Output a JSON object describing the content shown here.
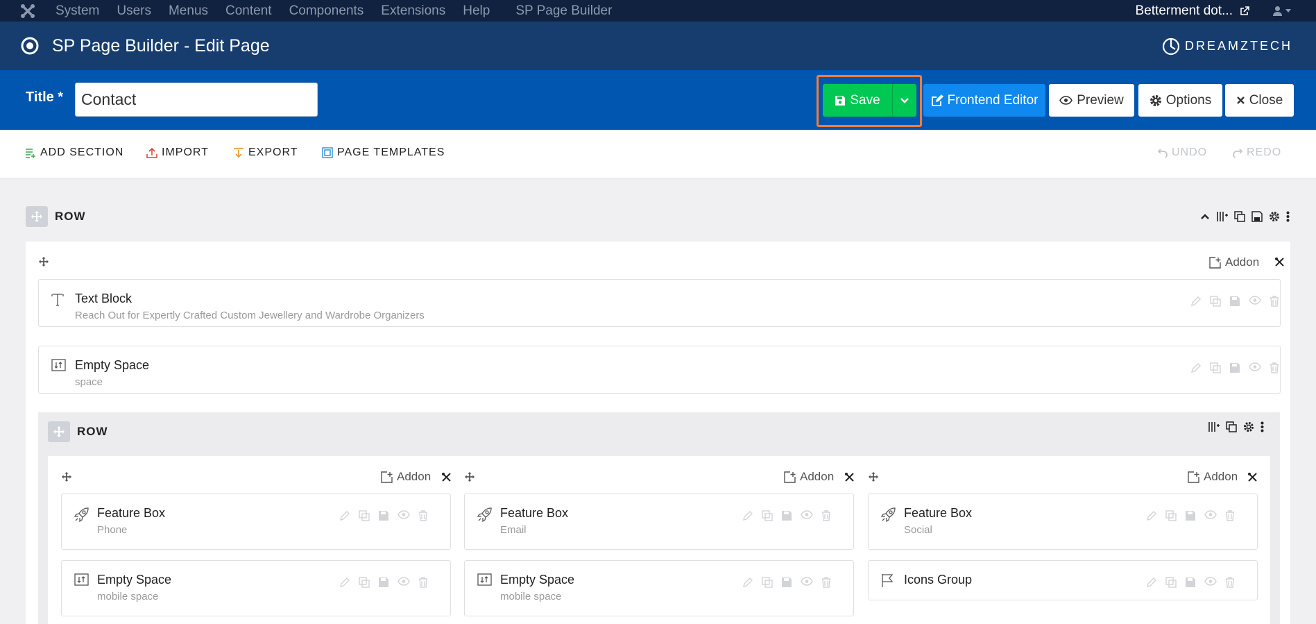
{
  "topbar": {
    "menu": [
      "System",
      "Users",
      "Menus",
      "Content",
      "Components",
      "Extensions",
      "Help",
      "SP Page Builder"
    ],
    "site_name": "Betterment dot..."
  },
  "header": {
    "title": "SP Page Builder - Edit Page",
    "brand": "DREAMZTECH"
  },
  "toolbar": {
    "title_label": "Title *",
    "title_value": "Contact",
    "save": "Save",
    "frontend_editor": "Frontend Editor",
    "preview": "Preview",
    "options": "Options",
    "close": "Close"
  },
  "actions": {
    "add_section": "ADD SECTION",
    "import": "IMPORT",
    "export": "EXPORT",
    "page_templates": "PAGE TEMPLATES",
    "undo": "UNDO",
    "redo": "REDO"
  },
  "row1": {
    "label": "ROW",
    "addon_label": "Addon",
    "addons": [
      {
        "name": "Text Block",
        "sub": "Reach Out for Expertly Crafted Custom Jewellery and Wardrobe Organizers",
        "icon": "text-block-icon"
      },
      {
        "name": "Empty Space",
        "sub": "space",
        "icon": "empty-space-icon"
      }
    ]
  },
  "row2": {
    "label": "ROW",
    "addon_label": "Addon",
    "columns": [
      {
        "addons": [
          {
            "name": "Feature Box",
            "sub": "Phone",
            "icon": "rocket-icon"
          },
          {
            "name": "Empty Space",
            "sub": "mobile space",
            "icon": "empty-space-icon"
          }
        ]
      },
      {
        "addons": [
          {
            "name": "Feature Box",
            "sub": "Email",
            "icon": "rocket-icon"
          },
          {
            "name": "Empty Space",
            "sub": "mobile space",
            "icon": "empty-space-icon"
          }
        ]
      },
      {
        "addons": [
          {
            "name": "Feature Box",
            "sub": "Social",
            "icon": "rocket-icon"
          },
          {
            "name": "Icons Group",
            "sub": "",
            "icon": "flag-icon"
          }
        ]
      }
    ]
  }
}
